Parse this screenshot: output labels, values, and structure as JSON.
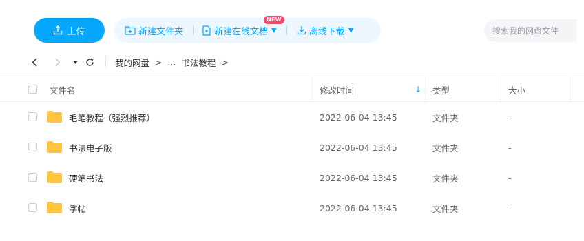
{
  "toolbar": {
    "upload_label": "上传",
    "new_folder_label": "新建文件夹",
    "new_online_doc_label": "新建在线文档",
    "new_badge": "NEW",
    "offline_download_label": "离线下载",
    "search_placeholder": "搜索我的网盘文件",
    "accent_color": "#06a7ff"
  },
  "breadcrumb": {
    "root": "我的网盘",
    "separator": ">",
    "ellipsis": "...",
    "current": "书法教程",
    "trailing_separator": ">"
  },
  "table": {
    "columns": {
      "name": "文件名",
      "modified": "修改时间",
      "type": "类型",
      "size": "大小"
    },
    "rows": [
      {
        "name": "毛笔教程（强烈推荐）",
        "modified": "2022-06-04 13:45",
        "type": "文件夹",
        "size": "-"
      },
      {
        "name": "书法电子版",
        "modified": "2022-06-04 13:45",
        "type": "文件夹",
        "size": "-"
      },
      {
        "name": "硬笔书法",
        "modified": "2022-06-04 13:45",
        "type": "文件夹",
        "size": "-"
      },
      {
        "name": "字帖",
        "modified": "2022-06-04 13:45",
        "type": "文件夹",
        "size": "-"
      }
    ]
  }
}
